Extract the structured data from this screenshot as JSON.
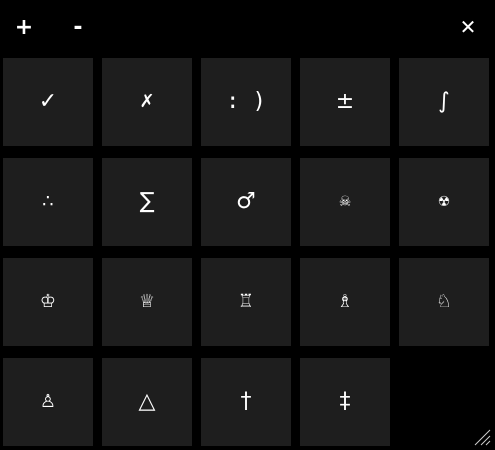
{
  "titlebar": {
    "zoom_in_label": "+",
    "zoom_out_label": "-",
    "close_label": "✕"
  },
  "palette": {
    "keys": [
      {
        "symbol": "✓",
        "icon": "checkmark-icon"
      },
      {
        "symbol": "✗",
        "icon": "ballot-x-icon"
      },
      {
        "symbol": ": )",
        "icon": "smiley-text-icon"
      },
      {
        "symbol": "±",
        "icon": "plus-minus-icon"
      },
      {
        "symbol": "∫",
        "icon": "integral-icon"
      },
      {
        "symbol": "∴",
        "icon": "therefore-icon"
      },
      {
        "symbol": "∑",
        "icon": "summation-icon"
      },
      {
        "symbol": "♂",
        "icon": "male-sign-icon"
      },
      {
        "symbol": "☠",
        "icon": "skull-crossbones-icon"
      },
      {
        "symbol": "☢",
        "icon": "radioactive-icon"
      },
      {
        "symbol": "♔",
        "icon": "chess-king-icon"
      },
      {
        "symbol": "♕",
        "icon": "chess-queen-icon"
      },
      {
        "symbol": "♖",
        "icon": "chess-rook-icon"
      },
      {
        "symbol": "♗",
        "icon": "chess-bishop-icon"
      },
      {
        "symbol": "♘",
        "icon": "chess-knight-icon"
      },
      {
        "symbol": "♙",
        "icon": "chess-pawn-icon"
      },
      {
        "symbol": "△",
        "icon": "triangle-icon"
      },
      {
        "symbol": "†",
        "icon": "dagger-icon"
      },
      {
        "symbol": "‡",
        "icon": "double-dagger-icon"
      }
    ]
  },
  "colors": {
    "background": "#000000",
    "key_background": "#1e1e1e",
    "glyph": "#ffffff"
  }
}
